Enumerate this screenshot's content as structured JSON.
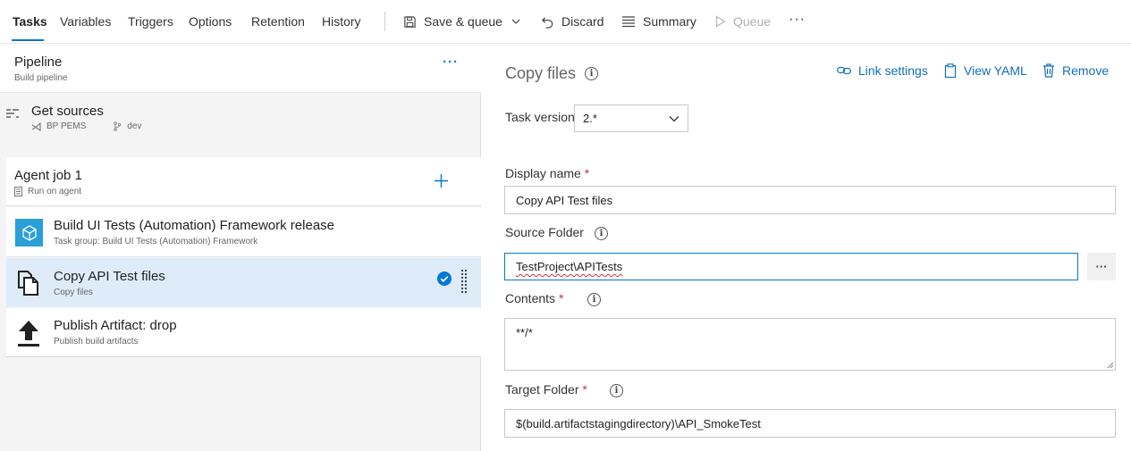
{
  "tabs": [
    {
      "label": "Tasks"
    },
    {
      "label": "Variables"
    },
    {
      "label": "Triggers"
    },
    {
      "label": "Options"
    },
    {
      "label": "Retention"
    },
    {
      "label": "History"
    }
  ],
  "toolbar": {
    "save_queue": "Save & queue",
    "discard": "Discard",
    "summary": "Summary",
    "queue": "Queue",
    "more": "···"
  },
  "pipeline": {
    "title": "Pipeline",
    "subtitle": "Build pipeline",
    "more": "···"
  },
  "get_sources": {
    "title": "Get sources",
    "repo": "BP PEMS",
    "branch": "dev"
  },
  "agent_job": {
    "title": "Agent job 1",
    "subtitle": "Run on agent"
  },
  "tasks": [
    {
      "title": "Build UI Tests (Automation) Framework release",
      "subtitle": "Task group: Build UI Tests (Automation) Framework"
    },
    {
      "title": "Copy API Test files",
      "subtitle": "Copy files"
    },
    {
      "title": "Publish Artifact: drop",
      "subtitle": "Publish build artifacts"
    }
  ],
  "detail": {
    "title": "Copy files",
    "link_settings": "Link settings",
    "view_yaml": "View YAML",
    "remove": "Remove",
    "task_version_label": "Task version",
    "task_version_value": "2.*",
    "display_name_label": "Display name",
    "display_name_value": "Copy API Test files",
    "source_folder_label": "Source Folder",
    "source_folder_value": "TestProject\\APITests",
    "contents_label": "Contents",
    "contents_value": "**/*",
    "target_folder_label": "Target Folder",
    "target_folder_value": "$(build.artifactstagingdirectory)\\API_SmokeTest",
    "browse": "···",
    "required_mark": "*",
    "info_mark": "i"
  },
  "colors": {
    "accent": "#0078d4",
    "selected_row": "#deecf9",
    "required": "#c4314b"
  }
}
